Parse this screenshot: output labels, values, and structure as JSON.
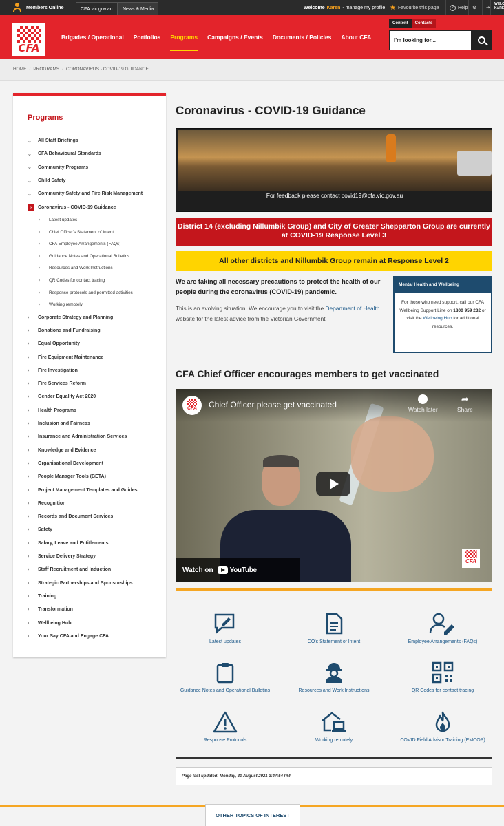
{
  "topbar": {
    "members_online": "Members Online",
    "links": [
      "CFA.vic.gov.au",
      "News & Media"
    ],
    "welcome_prefix": "Welcome",
    "user_name": "Karen",
    "welcome_suffix": "- manage my profile",
    "favourite": "Favourite this page",
    "help": "Help",
    "welcome_cut": "WELC KARE"
  },
  "header": {
    "logo_text": "CFA",
    "nav": [
      "Brigades / Operational",
      "Portfolios",
      "Programs",
      "Campaigns / Events",
      "Documents / Policies",
      "About CFA"
    ],
    "active_nav": "Programs",
    "search_tabs": [
      "Content",
      "Contacts"
    ],
    "search_placeholder": "I'm looking for..."
  },
  "breadcrumb": [
    "HOME",
    "PROGRAMS",
    "CORONAVIRUS - COVID-19 GUIDANCE"
  ],
  "sidebar": {
    "title": "Programs",
    "items": [
      {
        "label": "All Staff Briefings",
        "type": "item"
      },
      {
        "label": "CFA Behavioural Standards",
        "type": "item"
      },
      {
        "label": "Community Programs",
        "type": "item"
      },
      {
        "label": "Child Safety",
        "type": "item"
      },
      {
        "label": "Community Safety and Fire Risk Management",
        "type": "item"
      },
      {
        "label": "Coronavirus - COVID-19 Guidance",
        "type": "active"
      },
      {
        "label": "Latest updates",
        "type": "sub"
      },
      {
        "label": "Chief Officer's Statement of Intent",
        "type": "sub"
      },
      {
        "label": "CFA Employee Arrangements (FAQs)",
        "type": "sub"
      },
      {
        "label": "Guidance Notes and Operational Bulletins",
        "type": "sub"
      },
      {
        "label": "Resources and Work Instructions",
        "type": "sub"
      },
      {
        "label": "QR Codes for contact tracing",
        "type": "sub"
      },
      {
        "label": "Response protocols and permitted activities",
        "type": "sub"
      },
      {
        "label": "Working remotely",
        "type": "sub"
      },
      {
        "label": "Corporate Strategy and Planning",
        "type": "item"
      },
      {
        "label": "Donations and Fundraising",
        "type": "item"
      },
      {
        "label": "Equal Opportunity",
        "type": "item"
      },
      {
        "label": "Fire Equipment Maintenance",
        "type": "item"
      },
      {
        "label": "Fire Investigation",
        "type": "item"
      },
      {
        "label": "Fire Services Reform",
        "type": "item"
      },
      {
        "label": "Gender Equality Act 2020",
        "type": "item"
      },
      {
        "label": "Health Programs",
        "type": "item"
      },
      {
        "label": "Inclusion and Fairness",
        "type": "item"
      },
      {
        "label": "Insurance and Administration Services",
        "type": "item"
      },
      {
        "label": "Knowledge and Evidence",
        "type": "item"
      },
      {
        "label": "Organisational Development",
        "type": "item"
      },
      {
        "label": "People Manager Tools (BETA)",
        "type": "item"
      },
      {
        "label": "Project Management Templates and Guides",
        "type": "item"
      },
      {
        "label": "Recognition",
        "type": "item"
      },
      {
        "label": "Records and Document Services",
        "type": "item"
      },
      {
        "label": "Safety",
        "type": "item"
      },
      {
        "label": "Salary, Leave and Entitlements",
        "type": "item"
      },
      {
        "label": "Service Delivery Strategy",
        "type": "item"
      },
      {
        "label": "Staff Recruitment and Induction",
        "type": "item"
      },
      {
        "label": "Strategic Partnerships and Sponsorships",
        "type": "item"
      },
      {
        "label": "Training",
        "type": "item"
      },
      {
        "label": "Transformation",
        "type": "item"
      },
      {
        "label": "Wellbeing Hub",
        "type": "item"
      },
      {
        "label": "Your Say CFA and Engage CFA",
        "type": "item"
      }
    ]
  },
  "main": {
    "title": "Coronavirus - COVID-19 Guidance",
    "hero_caption": "For feedback please contact covid19@cfa.vic.gov.au",
    "alert_red": "District 14 (excluding Nillumbik Group) and City of Greater Shepparton Group are currently at COVID-19 Response Level 3",
    "alert_yellow": "All other districts and Nillumbik Group remain at Response Level 2",
    "lead": "We are taking all necessary precautions to protect the health of our people during the coronavirus (COVID-19) pandemic.",
    "para_start": "This is an evolving situation. We encourage you to visit the",
    "para_link": "Department of Health",
    "para_end": "website for the latest advice from the Victorian Government",
    "mental_health": {
      "heading": "Mental Health and Wellbeing",
      "text1": "For those who need support, call our CFA Wellbeing Support Line on",
      "phone": "1800 959 232",
      "text2": "or visit the",
      "link": "Wellbeing Hub",
      "text3": "for additional resources."
    },
    "video_heading": "CFA Chief Officer encourages members to get vaccinated",
    "video": {
      "channel": "CFA",
      "title": "Chief Officer please get vaccinated",
      "watch_later": "Watch later",
      "share": "Share",
      "watch_on": "Watch on",
      "youtube": "YouTube"
    },
    "quick_links": [
      {
        "label": "Latest updates",
        "icon": "edit-message-icon"
      },
      {
        "label": "CO's Statement of Intent",
        "icon": "document-icon"
      },
      {
        "label": "Employee Arrangements (FAQs)",
        "icon": "user-edit-icon"
      },
      {
        "label": "Guidance Notes and Operational Bulletins",
        "icon": "clipboard-icon"
      },
      {
        "label": "Resources and Work Instructions",
        "icon": "hardhat-worker-icon"
      },
      {
        "label": "QR Codes for contact tracing",
        "icon": "qr-code-icon"
      },
      {
        "label": "Response Protocols",
        "icon": "warning-icon"
      },
      {
        "label": "Working remotely",
        "icon": "house-laptop-icon"
      },
      {
        "label": "COVID Field Advisor Training (EMCOP)",
        "icon": "flame-icon"
      }
    ],
    "last_updated": "Page last updated:  Monday, 30 August 2021 3:47:54 PM"
  },
  "footer": {
    "other_topics": "OTHER TOPICS OF INTEREST"
  },
  "colors": {
    "brand_red": "#e3242b",
    "alert_yellow": "#ffd400",
    "accent_orange": "#f5a623",
    "link_blue": "#1e5a8a",
    "panel_navy": "#1e4b6e"
  }
}
